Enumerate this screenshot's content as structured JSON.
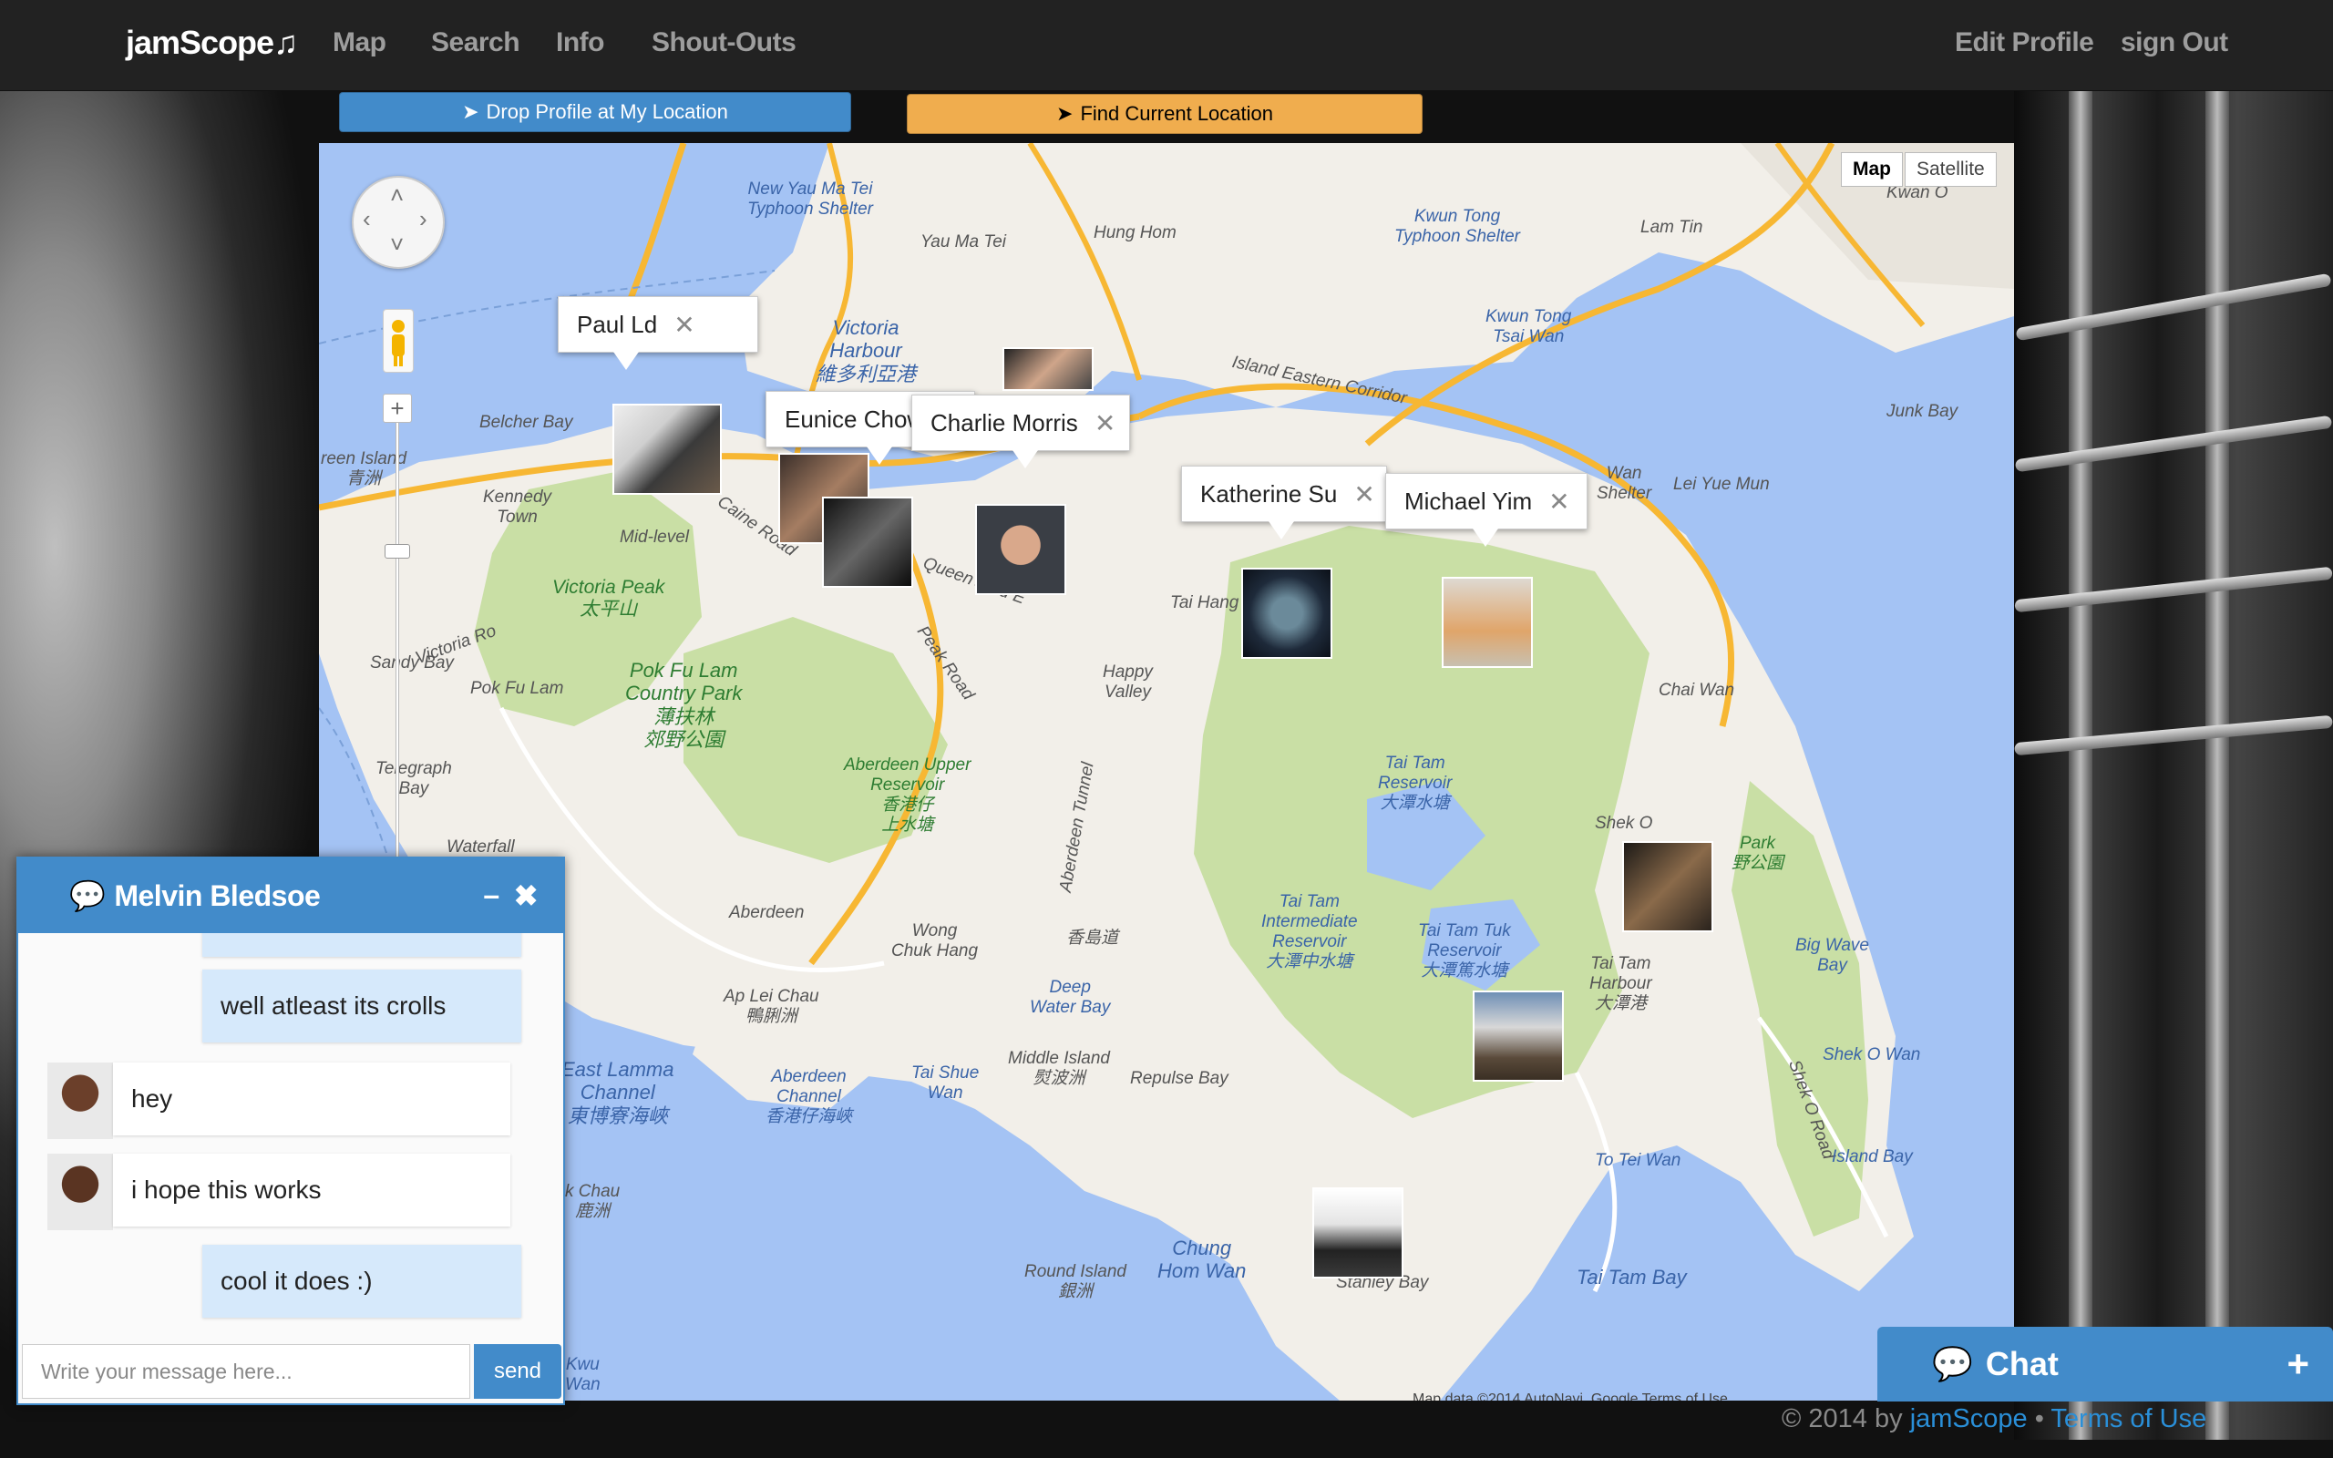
{
  "navbar": {
    "brand": "jamScope",
    "brand_icon": "music-note-icon",
    "links": [
      "Map",
      "Search",
      "Info",
      "Shout-Outs"
    ],
    "right_links": [
      "Edit Profile",
      "sign Out"
    ]
  },
  "actions": {
    "drop_profile": "Drop Profile at My Location",
    "find_location": "Find Current Location",
    "icon": "location-arrow-icon"
  },
  "map": {
    "type_buttons": [
      "Map",
      "Satellite"
    ],
    "zoom_in": "+",
    "zoom_out": "−",
    "copyright": "Map data ©2014 AutoNavi, Google   Terms of Use",
    "labels": {
      "new_yau_ma_tei": "New Yau Ma Tei\nTyphoon Shelter",
      "yau_ma_tei": "Yau Ma Tei",
      "hung_hom": "Hung Hom",
      "kwun_tong_shelter": "Kwun Tong\nTyphoon Shelter",
      "lam_tin": "Lam Tin",
      "kwan_o": "Kwan O",
      "victoria_harbour": "Victoria\nHarbour\n維多利亞港",
      "kwun_tong_tsai_wan": "Kwun Tong\nTsai Wan",
      "junk_bay": "Junk Bay",
      "island_eastern": "Island Eastern Corridor",
      "belcher_bay": "Belcher Bay",
      "green_island": "reen Island\n青洲",
      "kennedy_town": "Kennedy\nTown",
      "mid_level": "Mid-level",
      "caine_road": "Caine Road",
      "queens_rd": "Queen's Rd E",
      "lei_yue_mun": "Lei Yue Mun",
      "wan_shelter": "Wan\nShelter",
      "victoria_peak": "Victoria Peak\n太平山",
      "victoria_road": "Victoria Ro",
      "sandy_bay": "Sandy Bay",
      "pok_fu_lam_park": "Pok Fu Lam\nCountry Park\n薄扶林\n郊野公園",
      "pok_fu_lam": "Pok Fu Lam",
      "peak_road": "Peak Road",
      "tai_hang": "Tai Hang",
      "happy_valley": "Happy\nValley",
      "chai_wan": "Chai Wan",
      "telegraph_bay": "Telegraph\nBay",
      "aberdeen_reservoir": "Aberdeen Upper\nReservoir\n香港仔\n上水塘",
      "aberdeen_tunnel": "Aberdeen Tunnel",
      "tai_tam_reservoir": "Tai Tam\nReservoir\n大潭水塘",
      "shek_o": "Shek O",
      "park": "Park\n野公園",
      "waterfall": "Waterfall",
      "aberdeen": "Aberdeen",
      "wong_chuk_hang": "Wong\nChuk Hang",
      "island_road": "香島道",
      "tai_tam_intermediate": "Tai Tam\nIntermediate\nReservoir\n大潭中水塘",
      "tai_tam_tuk": "Tai Tam Tuk\nReservoir\n大潭篤水塘",
      "tai_tam_harbour": "Tai Tam\nHarbour\n大潭港",
      "big_wave_bay": "Big Wave\nBay",
      "ap_lei_chau": "Ap Lei Chau\n鴨脷洲",
      "deep_water_bay": "Deep\nWater Bay",
      "east_lamma": "East Lamma\nChannel\n東博寮海峽",
      "aberdeen_channel": "Aberdeen\nChannel\n香港仔海峽",
      "tai_shue_wan": "Tai Shue\nWan",
      "middle_island": "Middle Island\n熨波洲",
      "repulse_bay": "Repulse Bay",
      "shek_o_wan": "Shek O Wan",
      "shek_o_road": "Shek O Road",
      "to_tei_wan": "To Tei Wan",
      "island_bay": "Island Bay",
      "chung_hom_wan": "Chung\nHom Wan",
      "round_island": "Round Island\n銀洲",
      "stanley_bay": "Stanley Bay",
      "tai_tam_bay": "Tai Tam Bay",
      "kau_chau": "k Chau\n鹿洲",
      "kwu_wan": "Kwu\nWan"
    }
  },
  "markers": [
    {
      "name": "Paul Ld",
      "close": "✕"
    },
    {
      "name": "Eunice Chow",
      "close": "✕"
    },
    {
      "name": "Charlie Morris",
      "close": "✕"
    },
    {
      "name": "Katherine Su",
      "close": "✕"
    },
    {
      "name": "Michael Yim",
      "close": "✕"
    }
  ],
  "chat": {
    "user": "Melvin Bledsoe",
    "icon": "comment-icon",
    "minimize": "–",
    "close": "✖",
    "messages": [
      {
        "text": "well atleast its crolls",
        "mine": true
      },
      {
        "text": "hey",
        "mine": false
      },
      {
        "text": "i hope this works",
        "mine": false
      },
      {
        "text": "cool it does :)",
        "mine": true
      }
    ],
    "input_placeholder": "Write your message here...",
    "send": "send"
  },
  "chat_tab": {
    "label": "Chat",
    "icon": "wechat-icon",
    "plus": "+"
  },
  "footer": {
    "copyright": "© 2014 by",
    "brand": "jamScope",
    "separator": "•",
    "terms": "Terms of Use"
  },
  "colors": {
    "primary": "#428bca",
    "warning": "#f0ad4e",
    "navbar": "#222222",
    "water": "#a4c3f4",
    "land": "#f2efe9",
    "park": "#c9dfa5"
  }
}
